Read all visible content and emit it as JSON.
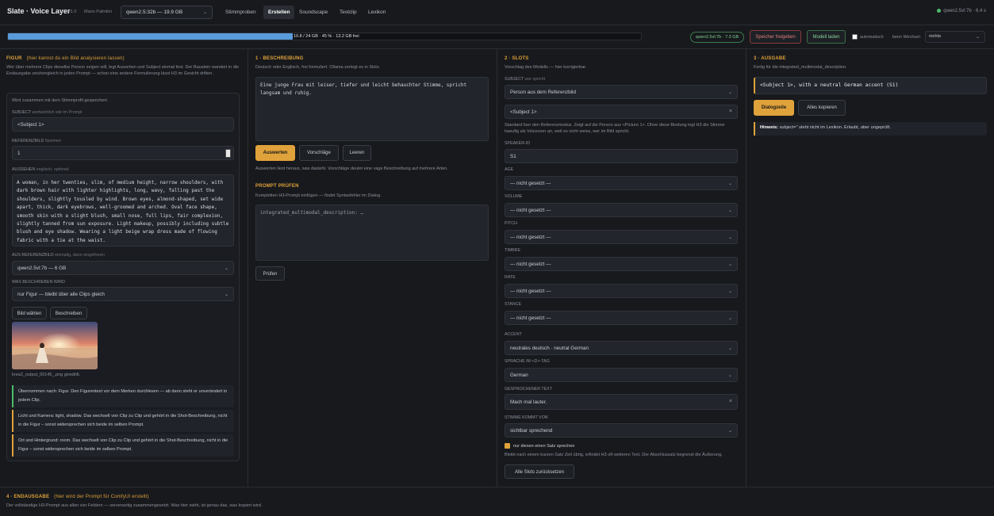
{
  "header": {
    "title": "Slate · Voice Layer",
    "version": "v1.0",
    "author": "Mario Palmtini",
    "model_select": "qwen2.5:32b — 19.9 GB",
    "tabs": [
      "Stimmproben",
      "Erstellen",
      "Soundscape",
      "Testclip",
      "Lexikon"
    ],
    "active_tab": "Erstellen",
    "status": "qwen2.5vl:7b · 6.4 s"
  },
  "memory": {
    "bar_text": "10.8 / 24 GB · 45 % · 13.2 GB frei",
    "fill_fraction": 0.45,
    "model_pill": "qwen2.5vl:7b · 7.3 GB",
    "free_button": "Speicher freigeben",
    "load_button": "Modell laden",
    "auto_label": "automatisch",
    "on_switch_label": "beim Wechsel:",
    "on_switch_value": "nichts"
  },
  "figur": {
    "heading": "FIGUR",
    "hint": "(hier kannst du ein Bild analysieren lassen)",
    "description": "Wer über mehrere Clips dieselbe Person zeigen will, legt Aussehen und Subject einmal fest. Der Baustein wandert in die Endausgabe zeichengleich in jeden Prompt — schon eine andere Formulierung lässt H3 im Gesicht driften.",
    "saved_note": "Wird zusammen mit dem Stimmprofil gespeichert.",
    "subject_label": "SUBJECT",
    "subject_hint": "wortwörtlich wie im Prompt",
    "subject_value": "<Subject 1>",
    "ref_label": "REFERENZBILD",
    "ref_hint": "Nummer",
    "ref_value": "1",
    "look_label": "AUSSEHEN",
    "look_hint": "englisch, optional",
    "look_value": "A woman, in her twenties, slim, of medium height, narrow shoulders, with dark brown hair with lighter highlights, long, wavy, falling past the shoulders, slightly tousled by wind. Brown eyes, almond-shaped, set wide apart, thick, dark eyebrows, well-groomed and arched. Oval face shape, smooth skin with a slight blush, small nose, full lips, fair complexion, slightly tanned from sun exposure. Light makeup, possibly including subtle blush and eye shadow. Wearing a light beige wrap dress made of flowing fabric with a tie at the waist.",
    "from_ref_label": "AUS REFERENZBILD",
    "from_ref_hint": "einmalig, dann eingefroren",
    "from_ref_value": "qwen2.5vl:7b — 6 GB",
    "what_label": "WAS BESCHRIEBEN WIRD",
    "what_value": "nur Figur — bleibt über alle Clips gleich",
    "choose_image": "Bild wählen",
    "describe": "Beschreiben",
    "filename": "krea2_output_00145_.png gewählt.",
    "notes": [
      {
        "text": "Übernommen nach: Figur. Den Figurentext vor dem Merken durchlesen — ab dann steht er unverändert in jedem Clip.",
        "kind": "green"
      },
      {
        "text": "Licht und Kamera: light, shadow. Das wechselt von Clip zu Clip und gehört in die Shot-Beschreibung, nicht in die Figur – sonst widersprechen sich beide im selben Prompt.",
        "kind": "yellow"
      },
      {
        "text": "Ort und Hintergrund: room. Das wechselt von Clip zu Clip und gehört in die Shot-Beschreibung, nicht in die Figur – sonst widersprechen sich beide im selben Prompt.",
        "kind": "yellow"
      }
    ]
  },
  "beschreibung": {
    "heading": "1 · BESCHREIBUNG",
    "sub": "Deutsch oder Englisch, frei formuliert. Ollama zerlegt es in Slots.",
    "text": "Eine junge Frau mit leiser, tiefer und leicht behauchter Stimme, spricht langsam und ruhig.",
    "btn_auswerten": "Auswerten",
    "btn_vorschlaege": "Vorschläge",
    "btn_leeren": "Leeren",
    "help": "Auswerten liest heraus, was dasteht. Vorschläge deutet eine vage Beschreibung auf mehrere Arten.",
    "pruefen_heading": "PROMPT PRÜFEN",
    "pruefen_sub": "Kompletten H3-Prompt einfügen — findet Syntaxfehler im Dialog.",
    "pruefen_text": "integrated_multimodal_description: …",
    "btn_pruefen": "Prüfen"
  },
  "slots": {
    "heading": "2 · SLOTS",
    "sub": "Vorschlag des Modells — hier korrigierbar.",
    "subject_label": "SUBJECT",
    "subject_hint": "wer spricht",
    "subject_select": "Person aus dem Referenzbild",
    "subject_value": "<Subject 1>",
    "subject_help": "Standard fuer den Referenzmodus. Zeigt auf die Person aus <Picture 1>. Ohne diese Bindung legt H3 die Stimme haeufig als Voiceover an, weil es nicht weiss, wer im Bild spricht.",
    "speaker_label": "SPEAKER-ID",
    "speaker_value": "S1",
    "fields": [
      {
        "label": "AGE",
        "value": "— nicht gesetzt —"
      },
      {
        "label": "VOLUME",
        "value": "— nicht gesetzt —"
      },
      {
        "label": "PITCH",
        "value": "— nicht gesetzt —"
      },
      {
        "label": "TIMBRE",
        "value": "— nicht gesetzt —"
      },
      {
        "label": "RATE",
        "value": "— nicht gesetzt —"
      },
      {
        "label": "STANCE",
        "value": "— nicht gesetzt —"
      },
      {
        "label": "ACCENT",
        "value": "neutrales deutsch · neutral German"
      },
      {
        "label": "SPRACHE IM <D>-TAG",
        "value": "German"
      }
    ],
    "spoken_label": "GESPROCHENER TEXT",
    "spoken_value": "Mach mal lauter.",
    "source_label": "STIMME KOMMT VON",
    "source_value": "sichtbar sprechend",
    "only_sentence": "nur diesen einen Satz sprechen",
    "only_help": "Bleibt nach einem kurzen Satz Zeit übrig, erfindet H3 oft weiteren Text. Der Abschlussatz begrenzt die Äußerung.",
    "reset": "Alle Slots zurücksetzen"
  },
  "ausgabe": {
    "heading": "3 · AUSGABE",
    "sub": "Fertig für die integrated_multimodal_description.",
    "output": "<Subject 1>, with a neutral German accent (S1)",
    "btn_dialog": "Dialogzeile",
    "btn_copy": "Alles kopieren",
    "hint_bold": "Hinweis:",
    "hint_text": "subject=\" steht nicht im Lexikon. Erlaubt, aber ungeprüft."
  },
  "endausgabe": {
    "heading": "4 · ENDAUSGABE",
    "hint": "(hier wird der Prompt für ComfyUI erstellt)",
    "sub": "Der vollständige H3-Prompt aus allen vier Feldern — serverseitig zusammengesetzt. Was hier steht, ist genau das, was kopiert wird."
  }
}
